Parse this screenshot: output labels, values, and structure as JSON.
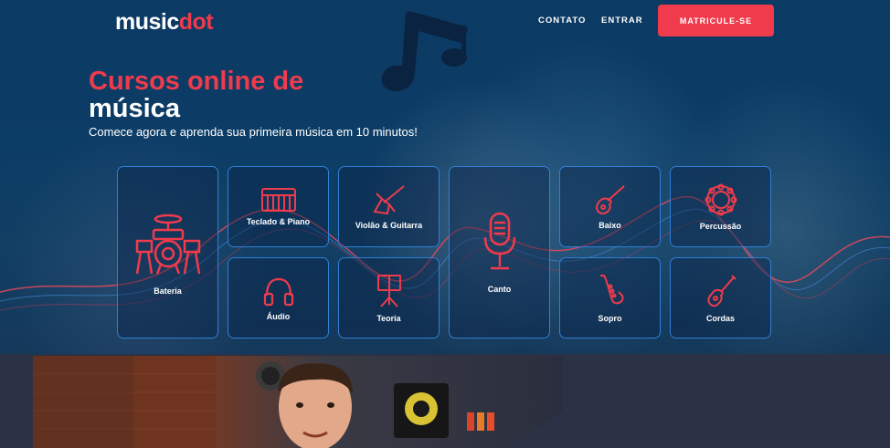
{
  "header": {
    "logo_part1": "music",
    "logo_part2": "dot",
    "nav": [
      "CONTATO",
      "ENTRAR"
    ],
    "cta_label": "MATRICULE-SE"
  },
  "hero": {
    "headline_line1": "Cursos online de",
    "headline_line2": "música",
    "subheadline": "Comece agora e aprenda sua primeira música em 10 minutos!"
  },
  "courses": [
    {
      "label": "Bateria",
      "icon": "drum-kit-icon"
    },
    {
      "label": "Teclado & Piano",
      "icon": "keyboard-icon"
    },
    {
      "label": "Violão & Guitarra",
      "icon": "guitar-icon"
    },
    {
      "label": "Canto",
      "icon": "microphone-icon"
    },
    {
      "label": "Baixo",
      "icon": "bass-icon"
    },
    {
      "label": "Percussão",
      "icon": "tambourine-icon"
    },
    {
      "label": "Áudio",
      "icon": "headphones-icon"
    },
    {
      "label": "Teoria",
      "icon": "music-stand-icon"
    },
    {
      "label": "Sopro",
      "icon": "saxophone-icon"
    },
    {
      "label": "Cordas",
      "icon": "ukulele-icon"
    }
  ],
  "colors": {
    "accent": "#ef3b4c",
    "card_border": "#2f7fd6",
    "background": "#0b3a63"
  }
}
